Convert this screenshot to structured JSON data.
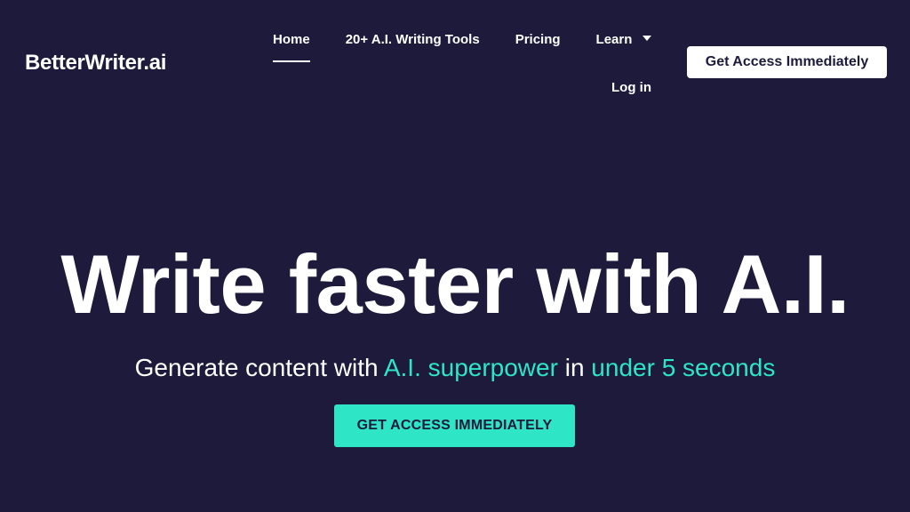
{
  "brand": {
    "name": "BetterWriter.ai"
  },
  "nav": {
    "items": [
      {
        "label": "Home",
        "active": true
      },
      {
        "label": "20+ A.I. Writing Tools",
        "active": false
      },
      {
        "label": "Pricing",
        "active": false
      },
      {
        "label": "Learn",
        "active": false,
        "has_dropdown": true
      }
    ],
    "login_label": "Log in",
    "cta_label": "Get Access Immediately"
  },
  "hero": {
    "title": "Write faster with A.I.",
    "subtitle_prefix": "Generate content with ",
    "subtitle_accent_1": "A.I. superpower",
    "subtitle_middle": " in ",
    "subtitle_accent_2": "under 5 seconds",
    "cta_label": "GET ACCESS IMMEDIATELY"
  },
  "colors": {
    "background": "#1d1a3c",
    "accent": "#2ee6c6",
    "text": "#ffffff",
    "button_text": "#1d1a3c"
  },
  "icons": {
    "learn_dropdown": "chevron-down-icon"
  }
}
